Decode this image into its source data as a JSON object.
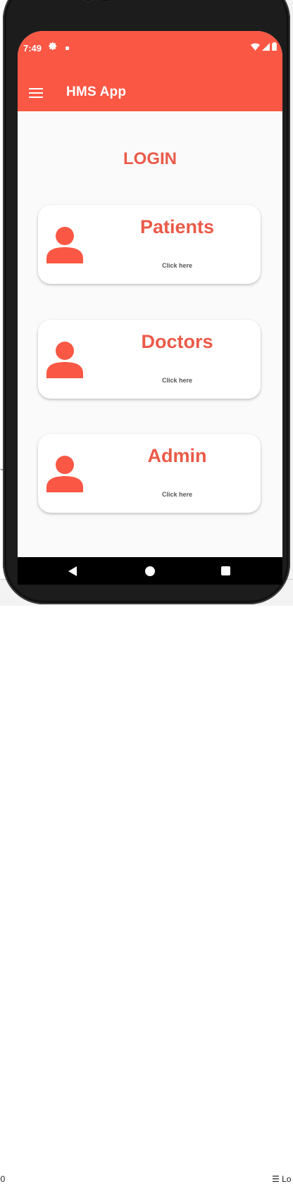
{
  "status_bar": {
    "time": "7:49",
    "icons": [
      "gear-icon",
      "notification-dot-icon",
      "wifi-icon",
      "signal-icon",
      "battery-icon"
    ]
  },
  "app_bar": {
    "title": "HMS App",
    "menu_icon": "hamburger-menu-icon"
  },
  "page": {
    "title": "LOGIN"
  },
  "cards": [
    {
      "title": "Patients",
      "subtitle": "Click here",
      "icon": "person-icon"
    },
    {
      "title": "Doctors",
      "subtitle": "Click here",
      "icon": "person-icon"
    },
    {
      "title": "Admin",
      "subtitle": "Click here",
      "icon": "person-icon"
    }
  ],
  "nav_bar": {
    "icons": [
      "back-icon",
      "home-icon",
      "recents-icon"
    ]
  },
  "desktop": {
    "left_fragment": "00",
    "right_fragment": "Lo"
  },
  "colors": {
    "primary": "#fa5744",
    "accent_text": "#ea5a48",
    "background": "#fafafa",
    "card": "#ffffff"
  }
}
